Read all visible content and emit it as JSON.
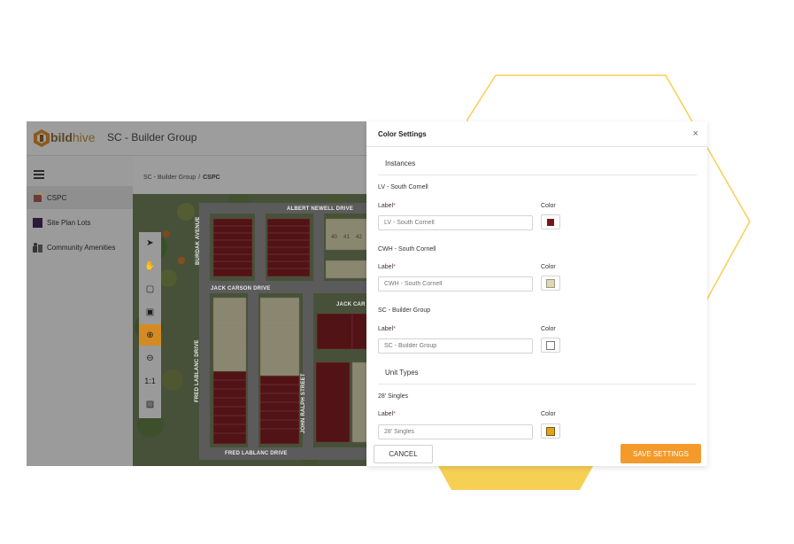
{
  "app": {
    "brand_bild": "bild",
    "brand_hive": "hive",
    "title": "SC - Builder Group"
  },
  "sidebar": {
    "items": [
      {
        "label": "CSPC",
        "icon": "map-pin-icon",
        "active": true
      },
      {
        "label": "Site Plan Lots",
        "icon": "lots-square-icon",
        "active": false
      },
      {
        "label": "Community Amenities",
        "icon": "amenities-icon",
        "active": false
      }
    ]
  },
  "breadcrumb": {
    "parent": "SC - Builder Group",
    "separator": "/",
    "current": "CSPC"
  },
  "map": {
    "streets": [
      "ALBERT NEWELL DRIVE",
      "BURDAK AVENUE",
      "JACK CARSON DRIVE",
      "JACK CAR",
      "FRED LABLANC DRIVE",
      "JOHN RALPH STREET",
      "FRED LABLANC DRIVE"
    ],
    "lot_numbers": [
      "40",
      "41",
      "42"
    ]
  },
  "toolbar": {
    "tools": [
      {
        "name": "select-arrow-icon",
        "glyph": "➤"
      },
      {
        "name": "pan-hand-icon",
        "glyph": "✋"
      },
      {
        "name": "draw-polygon-icon",
        "glyph": "▢"
      },
      {
        "name": "edit-polygon-icon",
        "glyph": "▣"
      },
      {
        "name": "zoom-in-icon",
        "glyph": "⊕"
      },
      {
        "name": "zoom-out-icon",
        "glyph": "⊖"
      },
      {
        "name": "actual-size-icon",
        "glyph": "1:1"
      },
      {
        "name": "image-icon",
        "glyph": "▨"
      }
    ],
    "active_tool": "zoom-in-icon"
  },
  "dialog": {
    "title": "Color Settings",
    "close": "×",
    "sections": {
      "instances": "Instances",
      "unit_types": "Unit Types"
    },
    "rows": [
      {
        "name": "LV - South Cornell",
        "label": "Label",
        "required": "*",
        "color_label": "Color",
        "placeholder": "LV - South Cornell",
        "color": "#7b1418"
      },
      {
        "name": "CWH - South Cornell",
        "label": "Label",
        "required": "*",
        "color_label": "Color",
        "placeholder": "CWH - South Cornell",
        "color": "#ddd7b4"
      },
      {
        "name": "SC - Builder Group",
        "label": "Label",
        "required": "*",
        "color_label": "Color",
        "placeholder": "SC - Builder Group",
        "color": "#ffffff"
      },
      {
        "name": "28' Singles",
        "label": "Label",
        "required": "*",
        "color_label": "Color",
        "placeholder": "28' Singles",
        "color": "#e3a21a"
      }
    ],
    "cancel_label": "CANCEL",
    "save_label": "SAVE SETTINGS"
  },
  "colors": {
    "accent": "#f39a2b",
    "hexagon": "#f6cf55"
  }
}
